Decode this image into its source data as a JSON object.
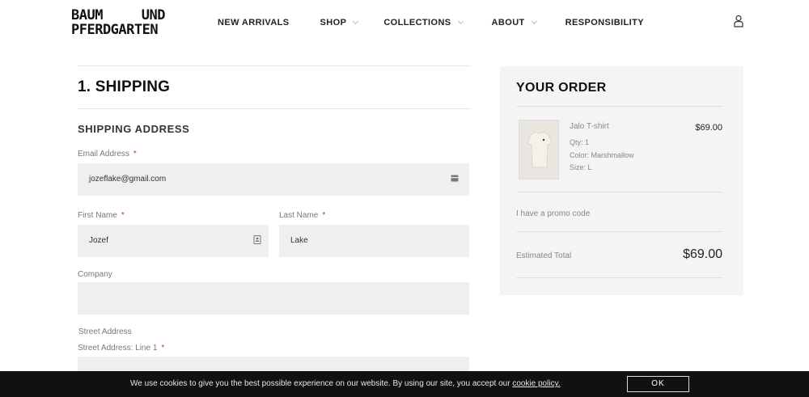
{
  "brand": {
    "line1_left": "BAUM",
    "line1_right": "UND",
    "line2": "PFERDGARTEN"
  },
  "nav": [
    {
      "label": "NEW ARRIVALS",
      "dropdown": false
    },
    {
      "label": "SHOP",
      "dropdown": true
    },
    {
      "label": "COLLECTIONS",
      "dropdown": true
    },
    {
      "label": "ABOUT",
      "dropdown": true
    },
    {
      "label": "RESPONSIBILITY",
      "dropdown": false
    }
  ],
  "icons": {
    "account": "user-icon",
    "email_field": "card-icon",
    "firstname_field": "contact-icon"
  },
  "shipping": {
    "title": "1. SHIPPING",
    "section": "SHIPPING ADDRESS",
    "email": {
      "label": "Email Address",
      "required": "*",
      "value": "jozeflake@gmail.com"
    },
    "first_name": {
      "label": "First Name",
      "required": "*",
      "value": "Jozef"
    },
    "last_name": {
      "label": "Last Name",
      "required": "*",
      "value": "Lake"
    },
    "company": {
      "label": "Company",
      "value": ""
    },
    "street_heading": "Street Address",
    "street1": {
      "label": "Street Address: Line 1",
      "required": "*"
    }
  },
  "order": {
    "title": "YOUR ORDER",
    "item": {
      "name": "Jalo T-shirt",
      "qty": "Qty: 1",
      "color": "Color: Marshmallow",
      "size": "Size: L",
      "price": "$69.00"
    },
    "promo": "I have a promo code",
    "total_label": "Estimated Total",
    "total_value": "$69.00"
  },
  "cookie": {
    "message": "We use cookies to give you the best possible experience on our website. By using our site, you accept our",
    "link": "cookie policy.",
    "ok": "OK"
  },
  "colors": {
    "field_bg": "#efefef",
    "panel_bg": "#f4f4f4",
    "cookie_bg": "#111111",
    "required": "#c0392b"
  }
}
